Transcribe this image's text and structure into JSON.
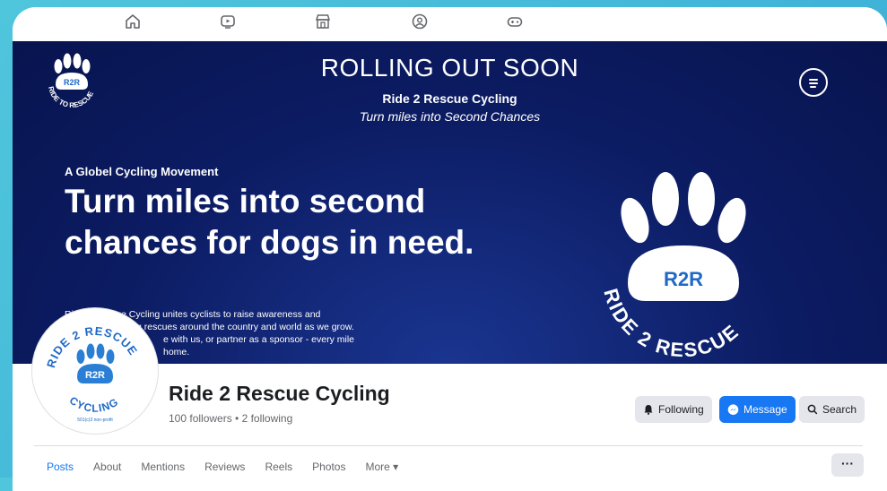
{
  "topnav": {
    "icons": [
      "home-icon",
      "video-icon",
      "marketplace-icon",
      "groups-icon",
      "gaming-icon"
    ]
  },
  "cover": {
    "heading": "ROLLING OUT SOON",
    "subheading": "Ride 2 Rescue Cycling",
    "subtitle": "Turn miles into Second Chances",
    "tagline": "A Globel Cycling Movement",
    "headline": "Turn miles into second chances for dogs in need.",
    "body_lines": [
      "Ride 2 Rescue Cycling unites cyclists to raise awareness and",
      "g rescues around the country and world as we grow.",
      "e with us, or partner as a sponsor - every mile",
      "home."
    ],
    "logo_text": "R2R",
    "logo_ring_text": "RIDE TO RESCUE",
    "big_logo_text": "R2R",
    "big_logo_ring_text": "RIDE 2 RESCUE",
    "accent_color": "#0c1c63"
  },
  "profile": {
    "avatar_top_text": "RIDE 2 RESCUE",
    "avatar_center_text": "R2R",
    "avatar_bottom_text": "CYCLING",
    "avatar_small_text": "501(c)3 non-profit",
    "name": "Ride 2 Rescue Cycling",
    "stats": "100 followers • 2 following"
  },
  "actions": {
    "following_label": "Following",
    "message_label": "Message",
    "search_label": "Search",
    "brand_color": "#1877f2"
  },
  "tabs": [
    {
      "label": "Posts",
      "active": true
    },
    {
      "label": "About"
    },
    {
      "label": "Mentions"
    },
    {
      "label": "Reviews"
    },
    {
      "label": "Reels"
    },
    {
      "label": "Photos"
    },
    {
      "label": "More ▾"
    }
  ],
  "more_label": "···"
}
